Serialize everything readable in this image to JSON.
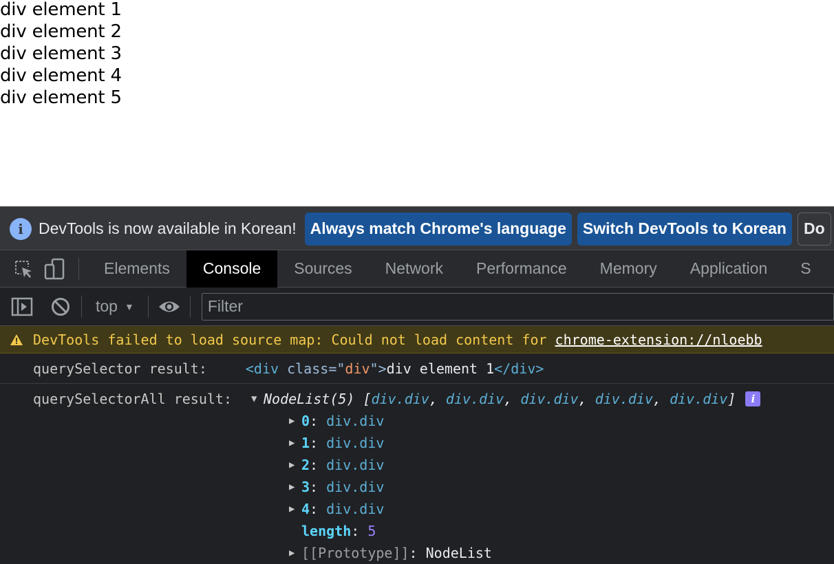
{
  "page": {
    "divs": [
      "div element 1",
      "div element 2",
      "div element 3",
      "div element 4",
      "div element 5"
    ]
  },
  "infobar": {
    "message": "DevTools is now available in Korean!",
    "btn_match": "Always match Chrome's language",
    "btn_switch": "Switch DevTools to Korean",
    "btn_dont": "Do"
  },
  "tabs": [
    "Elements",
    "Console",
    "Sources",
    "Network",
    "Performance",
    "Memory",
    "Application",
    "S"
  ],
  "active_tab": "Console",
  "toolbar": {
    "context": "top",
    "filter_placeholder": "Filter"
  },
  "console": {
    "warning_text": "DevTools failed to load source map: Could not load content for",
    "warning_link": "chrome-extension://nloebb",
    "qs_label": "querySelector result:",
    "qs_tag_open": "<div",
    "qs_attr_name": "class",
    "qs_attr_eq": "=\"",
    "qs_attr_val": "div",
    "qs_attr_close": "\">",
    "qs_text": "div element 1",
    "qs_tag_close": "</div>",
    "qsa_label": "querySelectorAll result:",
    "qsa_summary_name": "NodeList(5)",
    "qsa_summary_open": "[",
    "qsa_summary_items": [
      "div.div",
      "div.div",
      "div.div",
      "div.div",
      "div.div"
    ],
    "qsa_summary_close": "]",
    "items": [
      {
        "index": "0",
        "value": "div.div"
      },
      {
        "index": "1",
        "value": "div.div"
      },
      {
        "index": "2",
        "value": "div.div"
      },
      {
        "index": "3",
        "value": "div.div"
      },
      {
        "index": "4",
        "value": "div.div"
      }
    ],
    "length_key": "length",
    "length_value": "5",
    "prototype_key": "[[Prototype]]",
    "prototype_value": "NodeList"
  }
}
